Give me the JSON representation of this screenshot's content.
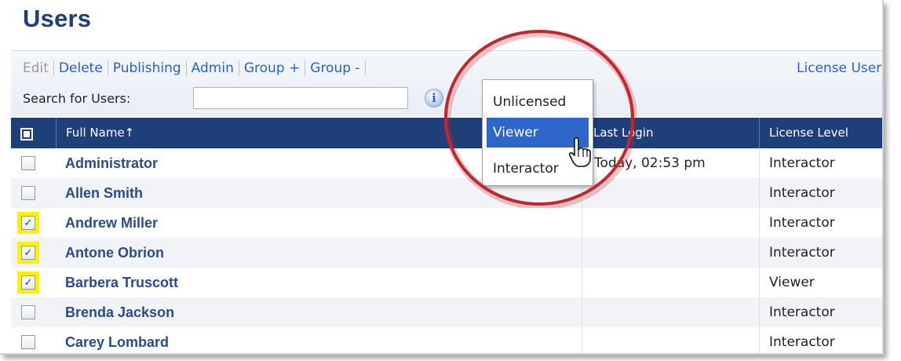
{
  "page": {
    "title": "Users"
  },
  "toolbar": {
    "actions": [
      {
        "label": "Edit",
        "disabled": true
      },
      {
        "label": "Delete",
        "disabled": false
      },
      {
        "label": "Publishing",
        "disabled": false
      },
      {
        "label": "Admin",
        "disabled": false
      },
      {
        "label": "Group +",
        "disabled": false
      },
      {
        "label": "Group -",
        "disabled": false
      },
      {
        "label": "License User",
        "disabled": false
      }
    ]
  },
  "search": {
    "label": "Search for Users:",
    "value": "",
    "info_icon": "i"
  },
  "table": {
    "columns": {
      "name": "Full Name",
      "sort_arrow": "↑",
      "last_login": "Last Login",
      "license_level": "License Level"
    },
    "rows": [
      {
        "name": "Administrator",
        "last_login": "Today, 02:53 pm",
        "license": "Interactor",
        "checked": false
      },
      {
        "name": "Allen Smith",
        "last_login": "",
        "license": "Interactor",
        "checked": false
      },
      {
        "name": "Andrew Miller",
        "last_login": "",
        "license": "Interactor",
        "checked": true
      },
      {
        "name": "Antone Obrion",
        "last_login": "",
        "license": "Interactor",
        "checked": true
      },
      {
        "name": "Barbera Truscott",
        "last_login": "",
        "license": "Viewer",
        "checked": true
      },
      {
        "name": "Brenda Jackson",
        "last_login": "",
        "license": "Interactor",
        "checked": false
      },
      {
        "name": "Carey Lombard",
        "last_login": "",
        "license": "Interactor",
        "checked": false
      }
    ]
  },
  "dropdown": {
    "items": [
      "Unlicensed",
      "Viewer",
      "Interactor"
    ],
    "active_index": 1
  },
  "colors": {
    "title": "#1f3f78",
    "header_bg": "#1f3f78",
    "link": "#2a61c9",
    "highlight": "#fff200",
    "menu_active": "#2e67c9",
    "annotation_circle": "#c0282d"
  },
  "icons": {
    "cursor": "hand-pointer-icon",
    "info": "info-icon",
    "checkbox": "checkbox-icon"
  }
}
